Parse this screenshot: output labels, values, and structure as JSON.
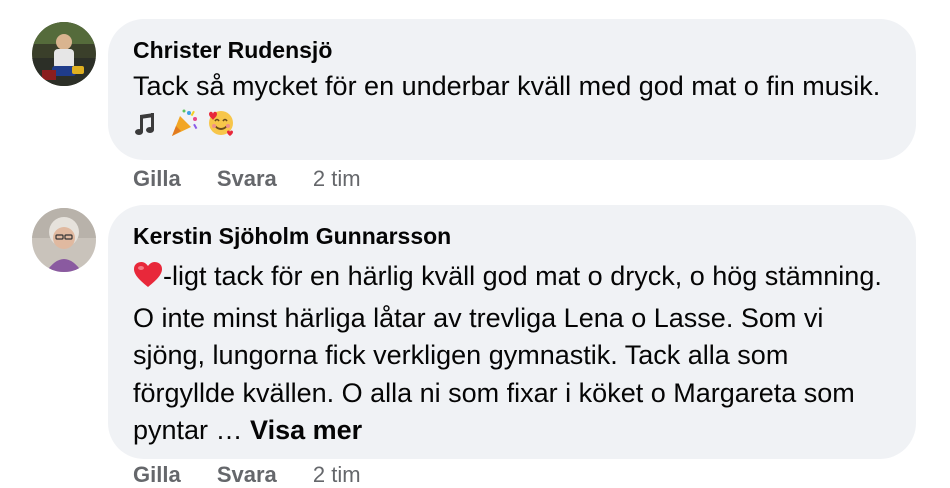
{
  "comments": [
    {
      "author": "Christer Rudensjö",
      "text": "Tack så mycket för en underbar kväll med god mat o fin musik.",
      "emojis": [
        "music-note-icon",
        "party-popper-icon",
        "smiling-face-with-hearts-icon"
      ],
      "actions": {
        "like": "Gilla",
        "reply": "Svara",
        "time": "2 tim"
      }
    },
    {
      "author": "Kerstin Sjöholm Gunnarsson",
      "emoji_prefix": "red-heart-icon",
      "text": "-ligt tack för en härlig kväll god mat o dryck, o hög stämning. O inte minst härliga låtar av trevliga Lena o Lasse. Som vi sjöng, lungorna fick verkligen gymnastik. Tack alla som förgyllde kvällen. O alla ni som fixar i köket o Margareta som pyntar … ",
      "see_more": "Visa mer",
      "actions": {
        "like": "Gilla",
        "reply": "Svara",
        "time": "2 tim"
      }
    }
  ],
  "colors": {
    "bubble_bg": "#f0f2f5",
    "text": "#050505",
    "secondary_text": "#65676b",
    "heart": "#e8283a"
  }
}
